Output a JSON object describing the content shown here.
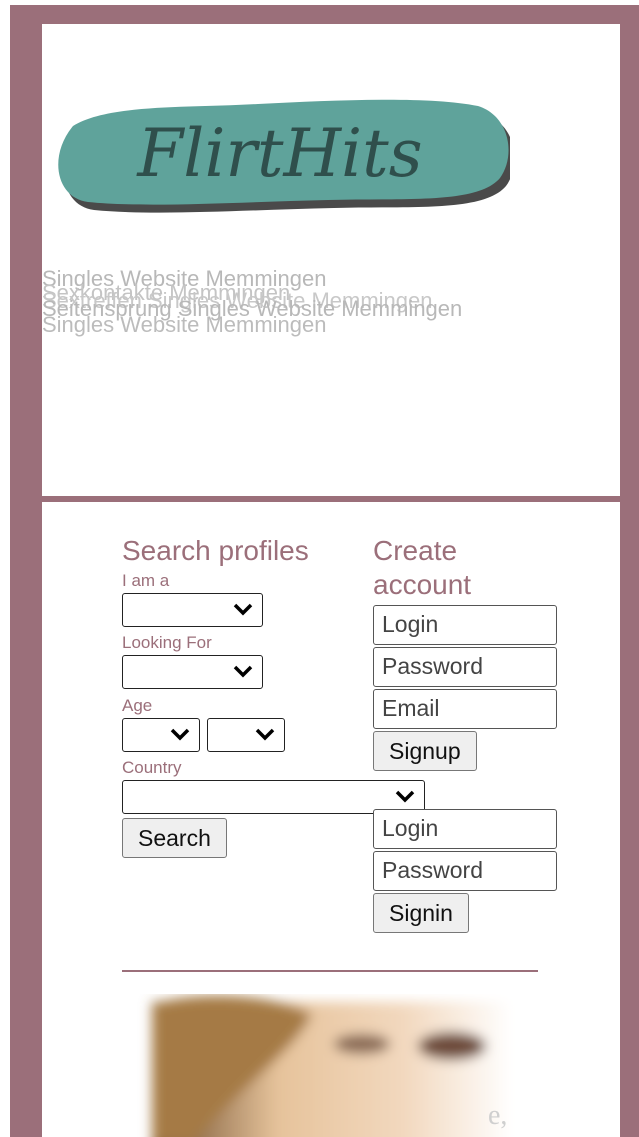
{
  "brand": {
    "logo_text": "FlirtHits"
  },
  "header": {
    "taglines": [
      "Singles Website Memmingen",
      "Sexkontakte Memmingen",
      "Sextreffen Singles Website Memmingen",
      "Seitensprung Singles Website Memmingen",
      "Singles Website Memmingen"
    ]
  },
  "search": {
    "title": "Search profiles",
    "i_am_label": "I am a",
    "looking_for_label": "Looking For",
    "age_label": "Age",
    "country_label": "Country",
    "search_button": "Search"
  },
  "signup": {
    "title_line1": "Create",
    "title_line2": "account",
    "login_placeholder": "Login",
    "password_placeholder": "Password",
    "email_placeholder": "Email",
    "signup_button": "Signup"
  },
  "signin": {
    "login_placeholder": "Login",
    "password_placeholder": "Password",
    "signin_button": "Signin"
  },
  "footer_fragment": {
    "text": "e,"
  },
  "colors": {
    "accent": "#9b6f7a",
    "logo_fill": "#5fa39b",
    "logo_text": "#2f4f4c"
  },
  "icons": {
    "dropdown": "chevron-down-icon"
  }
}
